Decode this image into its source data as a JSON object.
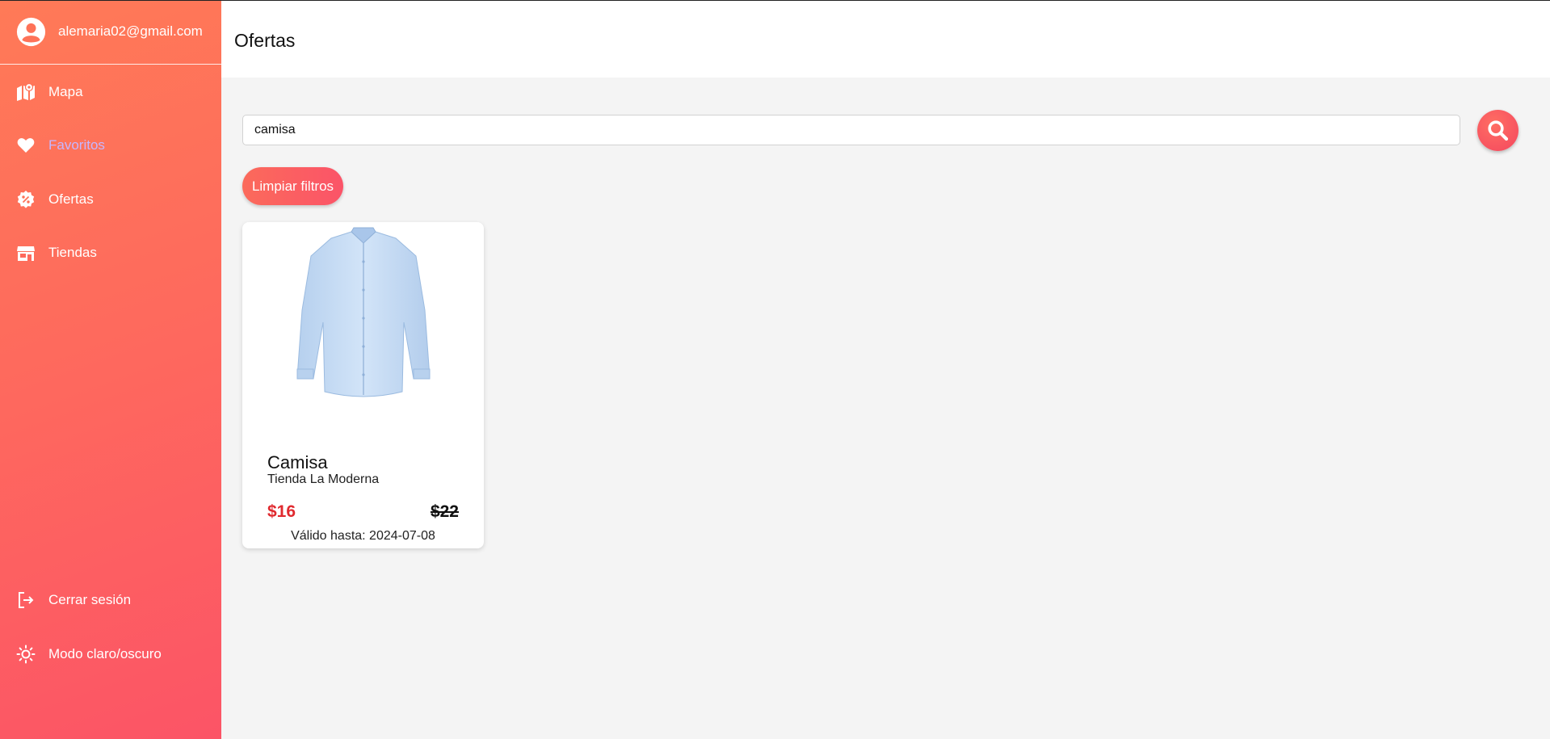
{
  "sidebar": {
    "email": "alemaria02@gmail.com",
    "items": [
      {
        "label": "Mapa",
        "icon": "map-icon"
      },
      {
        "label": "Favoritos",
        "icon": "heart-icon"
      },
      {
        "label": "Ofertas",
        "icon": "discount-badge-icon"
      },
      {
        "label": "Tiendas",
        "icon": "store-icon"
      }
    ],
    "logout_label": "Cerrar sesión",
    "theme_label": "Modo claro/oscuro"
  },
  "header": {
    "title": "Ofertas"
  },
  "search": {
    "value": "camisa"
  },
  "filters": {
    "clear_label": "Limpiar filtros"
  },
  "offers": [
    {
      "name": "Camisa",
      "store": "Tienda La Moderna",
      "price": "$16",
      "old_price": "$22",
      "valid_until": "Válido hasta: 2024-07-08"
    }
  ],
  "colors": {
    "sidebar_gradient_start": "#ff7a57",
    "sidebar_gradient_end": "#fc5466",
    "active_nav": "#c6b6ff",
    "price": "#e02a2f"
  }
}
